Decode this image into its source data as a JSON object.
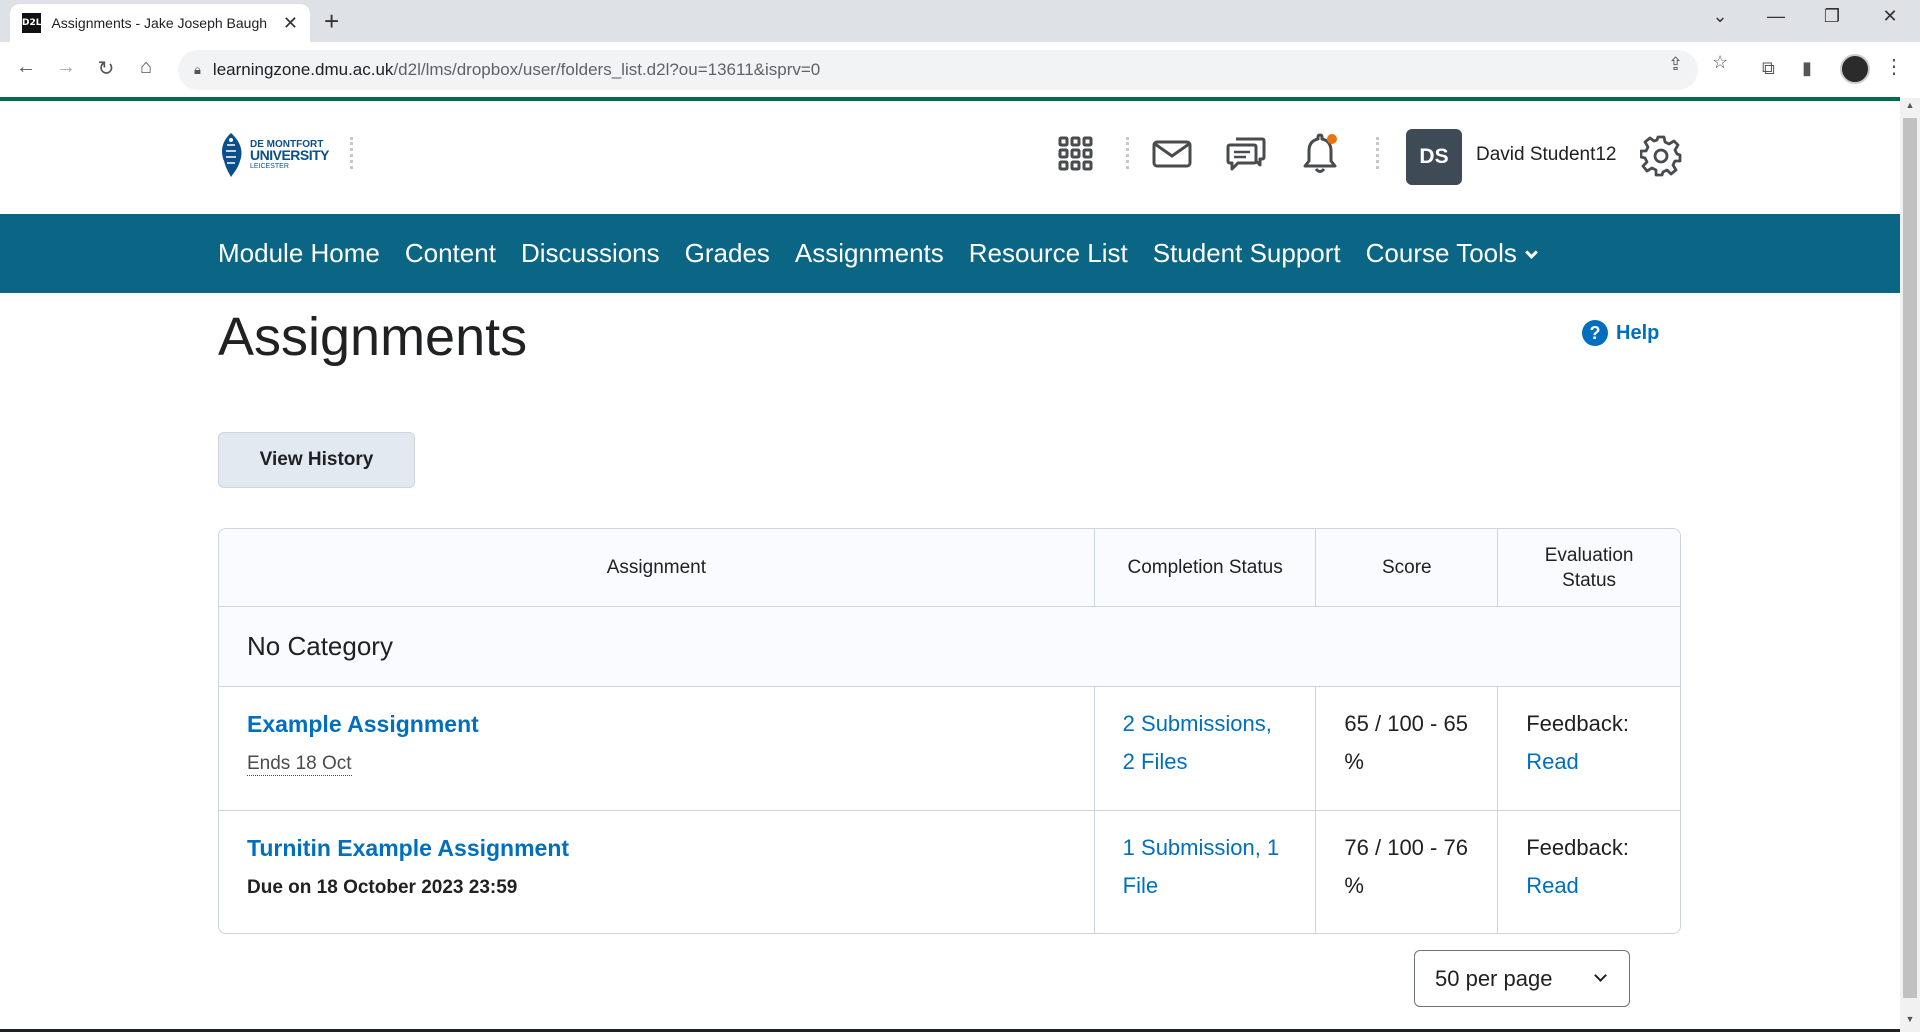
{
  "browser": {
    "tab_title": "Assignments - Jake Joseph Baugh",
    "favicon_text": "D2L",
    "url_host": "learningzone.dmu.ac.uk",
    "url_path": "/d2l/lms/dropbox/user/folders_list.d2l?ou=13611&isprv=0"
  },
  "header": {
    "logo": {
      "line1": "DE MONTFORT",
      "line2": "UNIVERSITY",
      "line3": "LEICESTER"
    },
    "avatar_initials": "DS",
    "user_name": "David Student12"
  },
  "nav": {
    "items": [
      "Module Home",
      "Content",
      "Discussions",
      "Grades",
      "Assignments",
      "Resource List",
      "Student Support"
    ],
    "more": "Course Tools"
  },
  "page": {
    "title": "Assignments",
    "help": "Help",
    "view_history": "View History"
  },
  "table": {
    "headers": [
      "Assignment",
      "Completion Status",
      "Score",
      "Evaluation Status"
    ],
    "category": "No Category",
    "rows": [
      {
        "name": "Example Assignment",
        "due": "Ends 18 Oct",
        "completion": "2 Submissions, 2 Files",
        "score": "65 / 100 - 65 %",
        "eval_label": "Feedback:",
        "eval_link": "Read"
      },
      {
        "name": "Turnitin Example Assignment",
        "due": "Due on 18 October 2023 23:59",
        "completion": "1 Submission, 1 File",
        "score": "76 / 100 - 76 %",
        "eval_label": "Feedback:",
        "eval_link": "Read"
      }
    ]
  },
  "pagination": {
    "per_page": "50 per page"
  },
  "colors": {
    "nav_bg": "#0b6585",
    "link": "#006fbf",
    "brand_green": "#006a50"
  }
}
